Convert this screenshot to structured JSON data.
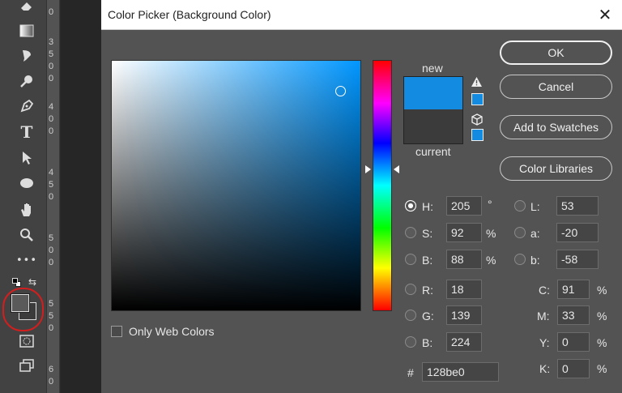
{
  "toolbar": {
    "tools": [
      {
        "name": "eraser-tool-icon",
        "glyph": "⌫"
      },
      {
        "name": "gradient-tool-icon",
        "glyph": "▭"
      },
      {
        "name": "blur-tool-icon",
        "glyph": "✎"
      },
      {
        "name": "dodge-tool-icon",
        "glyph": "⚲"
      },
      {
        "name": "pen-tool-icon",
        "glyph": "✒"
      },
      {
        "name": "type-tool-icon",
        "glyph": "T"
      },
      {
        "name": "path-selection-icon",
        "glyph": "➚"
      },
      {
        "name": "ellipse-tool-icon",
        "glyph": "⬭"
      },
      {
        "name": "hand-tool-icon",
        "glyph": "✋"
      },
      {
        "name": "zoom-tool-icon",
        "glyph": "⚲"
      },
      {
        "name": "more-tools-icon",
        "glyph": "•••"
      }
    ]
  },
  "ruler": {
    "digits": [
      "0",
      "3",
      "5",
      "0",
      "0",
      "4",
      "0",
      "0",
      "4",
      "5",
      "0",
      "5",
      "0",
      "0",
      "5",
      "5",
      "0",
      "6",
      "0"
    ]
  },
  "dialog": {
    "title": "Color Picker (Background Color)",
    "close_glyph": "✕",
    "new_label": "new",
    "current_label": "current",
    "colors": {
      "new": "#128be0",
      "current": "#3b3b3b"
    },
    "buttons": {
      "ok": "OK",
      "cancel": "Cancel",
      "add_to_swatches": "Add to Swatches",
      "color_libraries": "Color Libraries"
    },
    "hsb": {
      "h_label": "H:",
      "h_value": "205",
      "h_unit": "°",
      "s_label": "S:",
      "s_value": "92",
      "s_unit": "%",
      "b_label": "B:",
      "b_value": "88",
      "b_unit": "%"
    },
    "rgb": {
      "r_label": "R:",
      "r_value": "18",
      "g_label": "G:",
      "g_value": "139",
      "b_label": "B:",
      "b_value": "224"
    },
    "lab": {
      "l_label": "L:",
      "l_value": "53",
      "a_label": "a:",
      "a_value": "-20",
      "b_label": "b:",
      "b_value": "-58"
    },
    "cmyk": {
      "c_label": "C:",
      "c_value": "91",
      "c_unit": "%",
      "m_label": "M:",
      "m_value": "33",
      "m_unit": "%",
      "y_label": "Y:",
      "y_value": "0",
      "y_unit": "%",
      "k_label": "K:",
      "k_value": "0",
      "k_unit": "%"
    },
    "hex": {
      "label": "#",
      "value": "128be0"
    },
    "only_web_colors": "Only Web Colors"
  }
}
